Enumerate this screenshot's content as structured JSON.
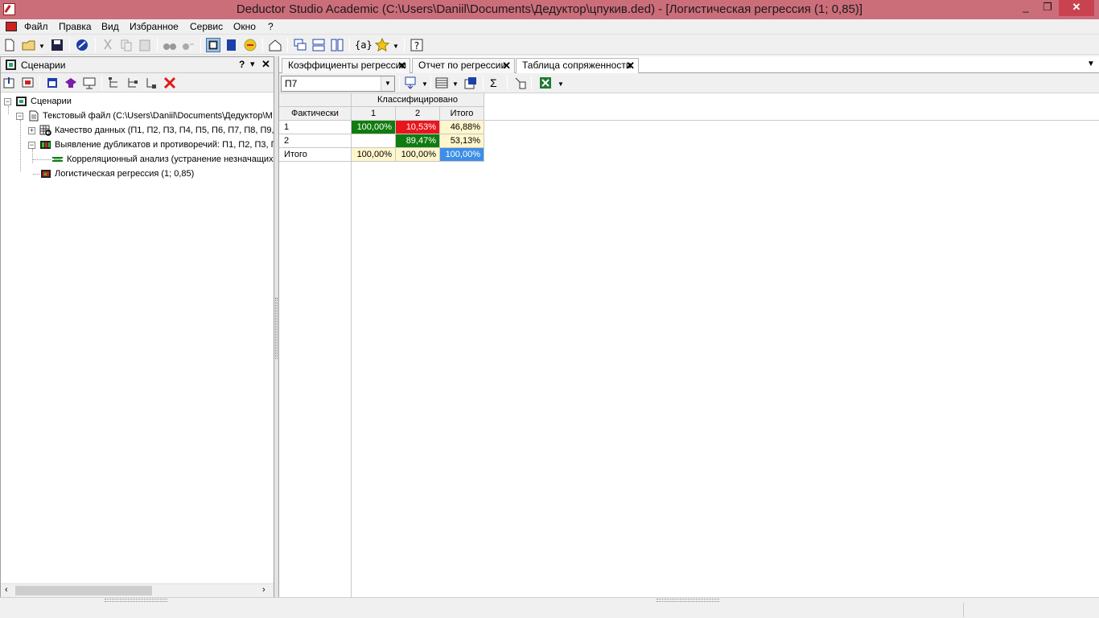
{
  "window": {
    "title": "Deductor Studio Academic (C:\\Users\\Daniil\\Documents\\Дедуктор\\цпукив.ded) - [Логистическая регрессия (1; 0,85)]",
    "minimize": "_",
    "maximize": "❐",
    "close": "✕"
  },
  "menu": [
    "Файл",
    "Правка",
    "Вид",
    "Избранное",
    "Сервис",
    "Окно",
    "?"
  ],
  "left_panel": {
    "title": "Сценарии",
    "help": "?",
    "pin": "▾",
    "close": "✕",
    "tree": [
      {
        "label": "Сценарии",
        "expander": "−"
      },
      {
        "label": "Текстовый файл (C:\\Users\\Daniil\\Documents\\Дедуктор\\М",
        "expander": "−"
      },
      {
        "label": "Качество данных (П1, П2, П3, П4, П5, П6, П7, П8, П9,",
        "expander": "+"
      },
      {
        "label": "Выявление дубликатов и противоречий: П1, П2, П3, П",
        "expander": "−"
      },
      {
        "label": "Корреляционный анализ (устранение незначащих",
        "expander": ""
      },
      {
        "label": "Логистическая регрессия (1; 0,85)",
        "expander": ""
      }
    ]
  },
  "tabs": [
    {
      "label": "Коэффициенты регрессии",
      "close": "✕"
    },
    {
      "label": "Отчет по регрессии",
      "close": "✕"
    },
    {
      "label": "Таблица сопряженности",
      "close": "✕"
    }
  ],
  "tabs_menu": "▼",
  "toolbar": {
    "combo_value": "П7",
    "sigma": "Σ"
  },
  "table": {
    "group_header": "Классифицировано",
    "actual_header": "Фактически",
    "columns": [
      "1",
      "2",
      "Итого"
    ],
    "rows": [
      {
        "label": "1",
        "cells": [
          "100,00%",
          "10,53%",
          "46,88%"
        ]
      },
      {
        "label": "2",
        "cells": [
          "",
          "89,47%",
          "53,13%"
        ]
      },
      {
        "label": "Итого",
        "cells": [
          "100,00%",
          "100,00%",
          "100,00%"
        ]
      }
    ]
  },
  "colors": {
    "title_bar": "#cc6e7a",
    "correct": "#0f7c0f",
    "error": "#e8151b",
    "total": "#fff6cc",
    "grand_total": "#3d8ee6"
  }
}
